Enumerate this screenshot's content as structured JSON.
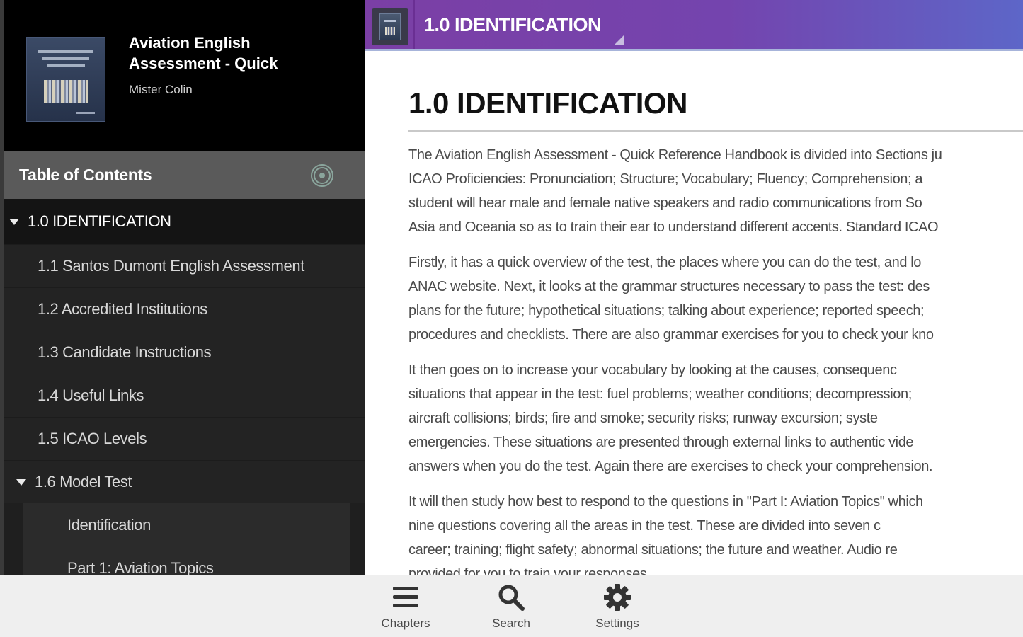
{
  "book": {
    "title": "Aviation English Assessment - Quick",
    "author": "Mister Colin"
  },
  "sidebar": {
    "toc_label": "Table of Contents",
    "items": [
      {
        "label": "1.0 IDENTIFICATION",
        "level": 0,
        "expanded": true
      },
      {
        "label": "1.1 Santos Dumont English Assessment",
        "level": 1
      },
      {
        "label": "1.2 Accredited Institutions",
        "level": 1
      },
      {
        "label": "1.3 Candidate Instructions",
        "level": 1
      },
      {
        "label": "1.4 Useful Links",
        "level": 1
      },
      {
        "label": "1.5 ICAO Levels",
        "level": 1
      },
      {
        "label": "1.6 Model Test",
        "level": 1,
        "expanded": true
      },
      {
        "label": "Identification",
        "level": 2
      },
      {
        "label": "Part 1: Aviation Topics",
        "level": 2
      }
    ]
  },
  "content": {
    "header_title": "1.0 IDENTIFICATION",
    "heading": "1.0 IDENTIFICATION",
    "paragraphs": [
      [
        "The Aviation English Assessment - Quick Reference Handbook is divided into Sections ju",
        "ICAO Proficiencies: Pronunciation; Structure; Vocabulary; Fluency; Comprehension; a",
        "student will hear male and female native speakers and radio communications from So",
        "Asia and Oceania so as to train their ear to understand different accents. Standard ICAO"
      ],
      [
        "Firstly, it has a quick overview of the test, the places where you can do the test, and lo",
        "ANAC website. Next, it looks at the grammar structures necessary to pass the test: des",
        "plans for the future; hypothetical situations; talking about experience; reported speech;",
        "procedures and checklists. There are also grammar exercises for you to check your kno"
      ],
      [
        "It then goes on to increase your vocabulary by looking at the causes, consequenc",
        "situations that appear in the test: fuel problems; weather conditions; decompression;",
        "aircraft collisions; birds; fire and smoke; security risks; runway excursion; syste",
        "emergencies. These situations are presented through external links to authentic vide",
        "answers when you do the test. Again there are exercises to check your comprehension."
      ],
      [
        "It will then study how best to respond to the questions in \"Part I: Aviation Topics\" which",
        "nine questions covering all the areas in the test. These are divided into seven c",
        "career; training; flight safety; abnormal situations; the future and weather. Audio re",
        "provided for you to train your responses."
      ]
    ]
  },
  "toolbar": {
    "chapters_label": "Chapters",
    "search_label": "Search",
    "settings_label": "Settings"
  },
  "colors": {
    "header_gradient_start": "#7b3fa5",
    "header_gradient_end": "#5d66c8",
    "sidebar_bg": "#1f1f1f",
    "toc_bar_bg": "#5a5a5a"
  },
  "icons": [
    "book-cover-icon",
    "target-icon",
    "caret-down-icon",
    "menu-icon",
    "search-icon",
    "gear-icon"
  ]
}
